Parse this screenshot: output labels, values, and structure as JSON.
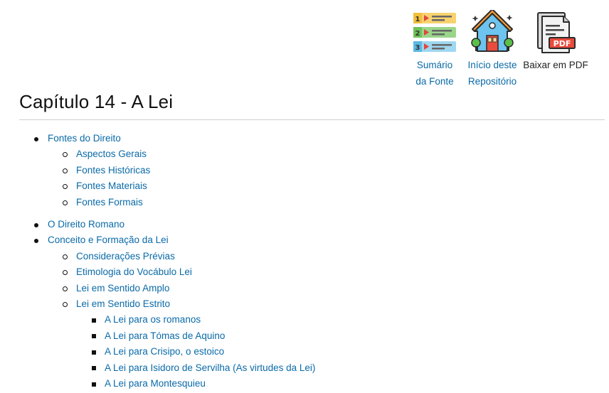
{
  "header": {
    "nav": [
      {
        "label_line1": "Sumário",
        "label_line2": "da Fonte",
        "icon": "numbered-list-icon"
      },
      {
        "label_line1": "Início deste",
        "label_line2": "Repositório",
        "icon": "house-icon"
      },
      {
        "label_line1": "Baixar em PDF",
        "icon": "pdf-file-icon"
      }
    ]
  },
  "page": {
    "title": "Capítulo 14 - A Lei"
  },
  "toc": [
    {
      "label": "Fontes do Direito",
      "children": [
        {
          "label": "Aspectos Gerais"
        },
        {
          "label": "Fontes Históricas"
        },
        {
          "label": "Fontes Materiais"
        },
        {
          "label": "Fontes Formais"
        }
      ]
    },
    {
      "label": "O Direito Romano"
    },
    {
      "label": "Conceito e Formação da Lei",
      "children": [
        {
          "label": "Considerações Prévias"
        },
        {
          "label": "Etimologia do Vocábulo Lei"
        },
        {
          "label": "Lei em Sentido Amplo"
        },
        {
          "label": "Lei em Sentido Estrito",
          "children": [
            {
              "label": "A Lei para os romanos"
            },
            {
              "label": "A Lei para Tómas de Aquino"
            },
            {
              "label": "A Lei para Crisipo, o estoico"
            },
            {
              "label": "A Lei para Isidoro de Servilha (As virtudes da Lei)"
            },
            {
              "label": "A Lei para Montesquieu"
            }
          ]
        }
      ]
    }
  ],
  "colors": {
    "link": "#0a6aa8",
    "text": "#222222",
    "rule": "#cfcfcf"
  }
}
